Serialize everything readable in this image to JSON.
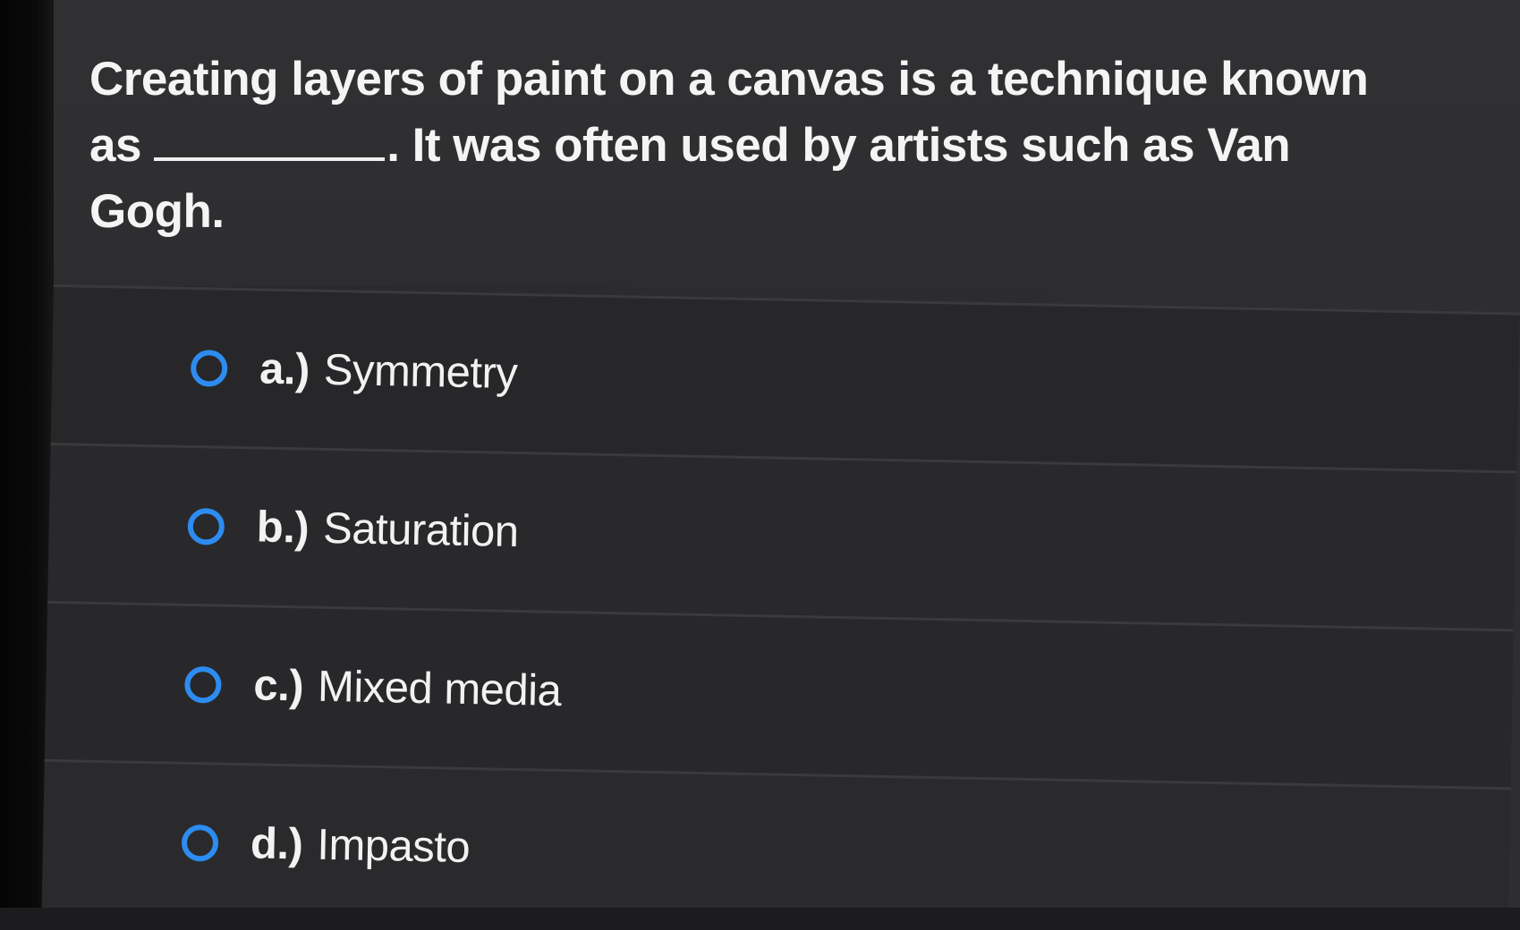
{
  "question": {
    "line_start": "Creating layers of paint on a canvas is a technique known as",
    "line_end": ". It was often used by artists such as Van Gogh."
  },
  "options": [
    {
      "letter": "a.)",
      "label": "Symmetry"
    },
    {
      "letter": "b.)",
      "label": "Saturation"
    },
    {
      "letter": "c.)",
      "label": "Mixed media"
    },
    {
      "letter": "d.)",
      "label": "Impasto"
    }
  ],
  "colors": {
    "radio_accent": "#2d8cf0",
    "background": "#2c2c2e",
    "text": "#f4f4f4"
  }
}
